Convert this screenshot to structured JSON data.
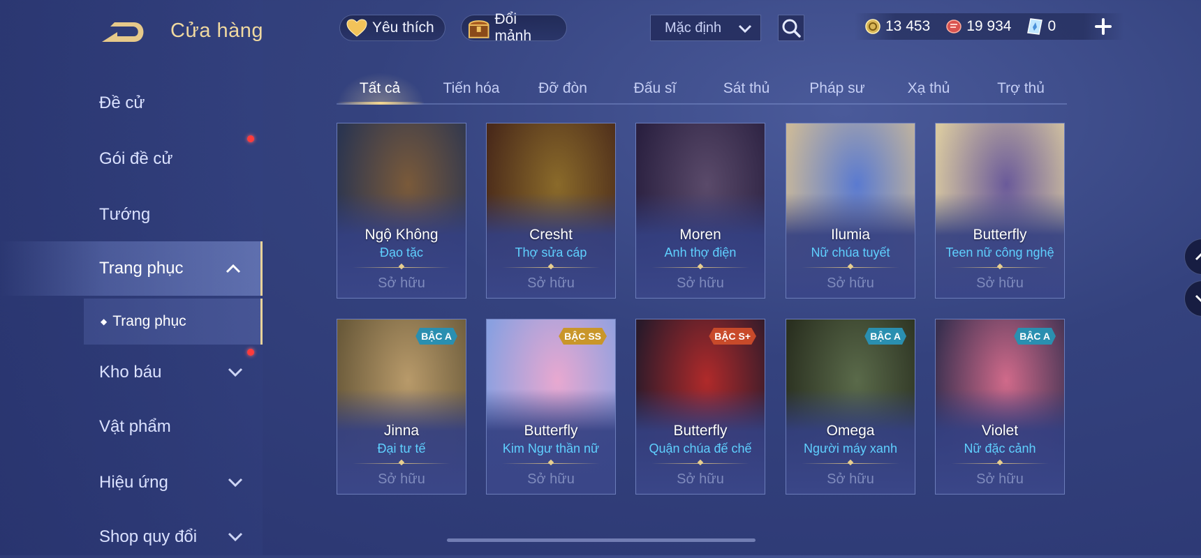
{
  "header": {
    "title": "Cửa hàng",
    "favorites_label": "Yêu thích",
    "exchange_label": "Đổi mảnh",
    "sort_value": "Mặc định",
    "currencies": [
      {
        "name": "gold",
        "value": "13 453",
        "color": "#d9b657"
      },
      {
        "name": "coupons",
        "value": "19 934",
        "color": "#d9534f"
      },
      {
        "name": "gems",
        "value": "0",
        "color": "#7fc8ff"
      }
    ]
  },
  "sidebar": {
    "items": [
      {
        "label": "Đề cử"
      },
      {
        "label": "Gói đề cử"
      },
      {
        "label": "Tướng"
      },
      {
        "label": "Trang phục"
      },
      {
        "label": "Kho báu"
      },
      {
        "label": "Vật phẩm"
      },
      {
        "label": "Hiệu ứng"
      },
      {
        "label": "Shop quy đổi"
      }
    ],
    "sub_item": "Trang phục"
  },
  "tabs": [
    "Tất cả",
    "Tiến hóa",
    "Đỡ đòn",
    "Đấu sĩ",
    "Sát thủ",
    "Pháp sư",
    "Xạ thủ",
    "Trợ thủ"
  ],
  "active_tab": "Tất cả",
  "skins": [
    {
      "hero": "Ngộ Không",
      "skin": "Đạo tặc",
      "status": "Sở hữu",
      "tier": "",
      "c1": "#7a5a3a",
      "c2": "#2b3550"
    },
    {
      "hero": "Cresht",
      "skin": "Thợ sửa cáp",
      "status": "Sở hữu",
      "tier": "",
      "c1": "#8a6a2a",
      "c2": "#4a2a1a"
    },
    {
      "hero": "Moren",
      "skin": "Anh thợ điện",
      "status": "Sở hữu",
      "tier": "",
      "c1": "#5a4a6a",
      "c2": "#2a2040"
    },
    {
      "hero": "Ilumia",
      "skin": "Nữ chúa tuyết",
      "status": "Sở hữu",
      "tier": "",
      "c1": "#5a7ad0",
      "c2": "#c9b89a"
    },
    {
      "hero": "Butterfly",
      "skin": "Teen nữ công nghệ",
      "status": "Sở hữu",
      "tier": "",
      "c1": "#6a5a9a",
      "c2": "#d8c8a0"
    },
    {
      "hero": "Jinna",
      "skin": "Đại tư tế",
      "status": "Sở hữu",
      "tier": "BẬC A",
      "c1": "#b89a6a",
      "c2": "#6a5a3a"
    },
    {
      "hero": "Butterfly",
      "skin": "Kim Ngư thần nữ",
      "status": "Sở hữu",
      "tier": "BẬC SS",
      "c1": "#e8a8d0",
      "c2": "#8aa0e0"
    },
    {
      "hero": "Butterfly",
      "skin": "Quận chúa đế chế",
      "status": "Sở hữu",
      "tier": "BẬC S+",
      "c1": "#b02a2a",
      "c2": "#2a1a2a"
    },
    {
      "hero": "Omega",
      "skin": "Người máy xanh",
      "status": "Sở hữu",
      "tier": "BẬC A",
      "c1": "#5a6a4a",
      "c2": "#2a3020"
    },
    {
      "hero": "Violet",
      "skin": "Nữ đặc cảnh",
      "status": "Sở hữu",
      "tier": "BẬC A",
      "c1": "#d06a8a",
      "c2": "#3a3050"
    }
  ],
  "tier_colors": {
    "BẬC A": "#2a8fb0",
    "BẬC SS": "#c9962a",
    "BẬC S+": "#c84a2a"
  },
  "accent": "#f0d9a0"
}
